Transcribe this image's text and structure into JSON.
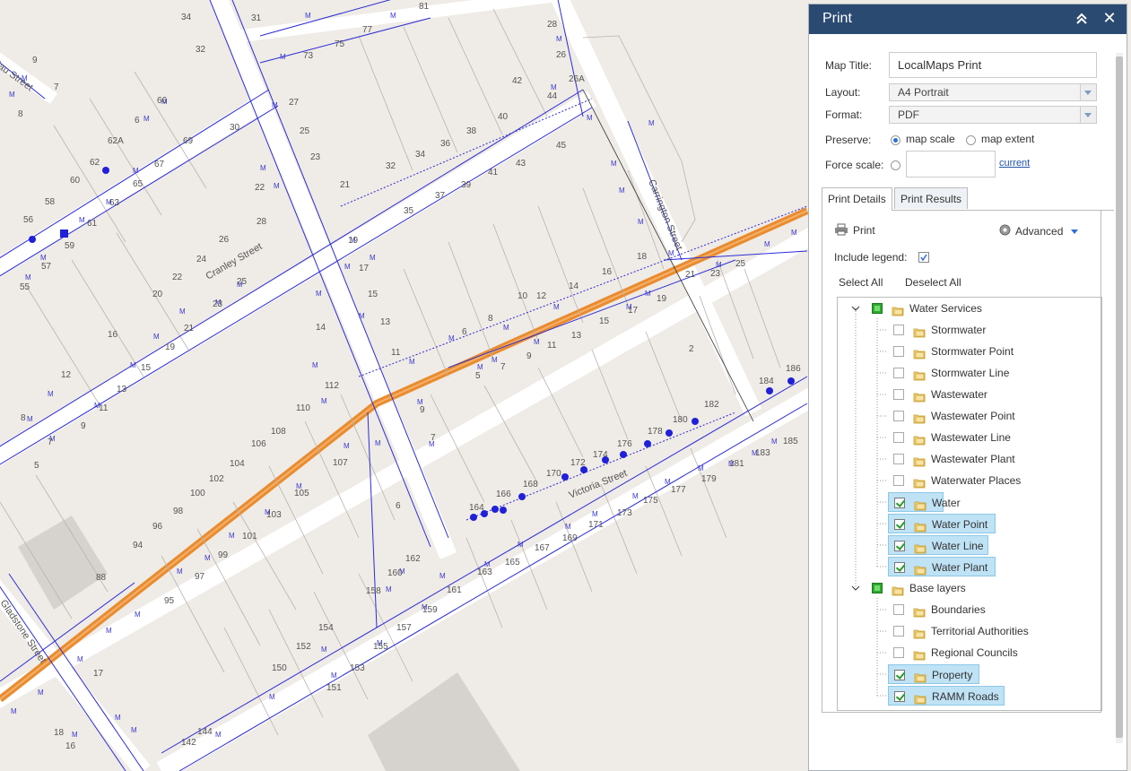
{
  "map": {
    "streets": [
      "Cranley Street",
      "Carrington Street",
      "Victoria Street",
      "Gladstone Street",
      "Mau Street"
    ],
    "labels": [
      "34",
      "31",
      "81",
      "77",
      "75",
      "73",
      "28",
      "26",
      "26A",
      "42",
      "44",
      "9",
      "7",
      "8",
      "66",
      "62A",
      "62",
      "60",
      "58",
      "56",
      "59",
      "57",
      "55",
      "53",
      "69",
      "67",
      "65",
      "63",
      "61",
      "32",
      "30",
      "27",
      "25",
      "23",
      "22",
      "21",
      "20",
      "19",
      "18",
      "17",
      "16",
      "15",
      "14",
      "13",
      "12",
      "11",
      "10",
      "6",
      "5",
      "3",
      "2",
      "38",
      "40",
      "36",
      "34",
      "32",
      "39",
      "37",
      "35",
      "41",
      "43",
      "45",
      "24",
      "26",
      "24",
      "22",
      "110",
      "112",
      "108",
      "106",
      "104",
      "102",
      "100",
      "98",
      "96",
      "94",
      "107",
      "105",
      "103",
      "101",
      "99",
      "97",
      "95",
      "88",
      "164",
      "166",
      "168",
      "170",
      "172",
      "174",
      "176",
      "178",
      "180",
      "182",
      "184",
      "186",
      "175",
      "173",
      "171",
      "169",
      "167",
      "165",
      "163",
      "161",
      "159",
      "157",
      "155",
      "153",
      "151",
      "150",
      "152",
      "154",
      "156",
      "158",
      "160",
      "162",
      "142",
      "144",
      "177",
      "179",
      "181",
      "183",
      "185",
      "2",
      "9",
      "25",
      "23",
      "21",
      "19",
      "17",
      "15",
      "13",
      "11",
      "9",
      "7",
      "5",
      "1"
    ]
  },
  "panel": {
    "title": "Print",
    "map_title_label": "Map Title:",
    "map_title_value": "LocalMaps Print",
    "layout_label": "Layout:",
    "layout_value": "A4 Portrait",
    "format_label": "Format:",
    "format_value": "PDF",
    "preserve_label": "Preserve:",
    "preserve_scale": "map scale",
    "preserve_extent": "map extent",
    "force_scale_label": "Force scale:",
    "force_scale_value": "",
    "current_link": "current",
    "tabs": [
      "Print Details",
      "Print Results"
    ],
    "print_button": "Print",
    "advanced_button": "Advanced",
    "include_legend_label": "Include legend:",
    "select_all": "Select All",
    "deselect_all": "Deselect All",
    "layers": [
      {
        "name": "Water Services",
        "group": true,
        "state": "partial"
      },
      {
        "name": "Stormwater",
        "checked": false
      },
      {
        "name": "Stormwater Point",
        "checked": false
      },
      {
        "name": "Stormwater Line",
        "checked": false
      },
      {
        "name": "Wastewater",
        "checked": false
      },
      {
        "name": "Wastewater Point",
        "checked": false
      },
      {
        "name": "Wastewater Line",
        "checked": false
      },
      {
        "name": "Wastewater Plant",
        "checked": false
      },
      {
        "name": "Waterwater Places",
        "checked": false
      },
      {
        "name": "Water",
        "checked": true
      },
      {
        "name": "Water Point",
        "checked": true
      },
      {
        "name": "Water Line",
        "checked": true
      },
      {
        "name": "Water Plant",
        "checked": true
      },
      {
        "name": "Base layers",
        "group": true,
        "state": "partial"
      },
      {
        "name": "Boundaries",
        "checked": false
      },
      {
        "name": "Territorial Authorities",
        "checked": false
      },
      {
        "name": "Regional Councils",
        "checked": false
      },
      {
        "name": "Property",
        "checked": true
      },
      {
        "name": "RAMM Roads",
        "checked": true
      }
    ]
  }
}
